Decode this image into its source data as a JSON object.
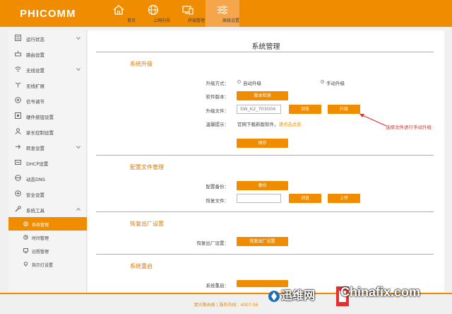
{
  "brand": "PHICOMM",
  "nav": [
    {
      "label": "首页",
      "icon": "home-icon"
    },
    {
      "label": "上网向导",
      "icon": "globe-icon"
    },
    {
      "label": "终端管理",
      "icon": "devices-icon"
    },
    {
      "label": "高级设置",
      "icon": "sliders-icon",
      "active": true
    }
  ],
  "sidebar": {
    "items": [
      {
        "label": "运行状态",
        "icon": "status-icon",
        "expandable": true
      },
      {
        "label": "路由设置",
        "icon": "router-icon"
      },
      {
        "label": "无线设置",
        "icon": "wifi-icon",
        "expandable": true
      },
      {
        "label": "无线扩展",
        "icon": "wireless-extend-icon"
      },
      {
        "label": "信号调节",
        "icon": "signal-icon"
      },
      {
        "label": "硬件按钮设置",
        "icon": "hardware-button-icon"
      },
      {
        "label": "家长控制设置",
        "icon": "parent-control-icon"
      },
      {
        "label": "转发设置",
        "icon": "forward-icon",
        "expandable": true
      },
      {
        "label": "DHCP设置",
        "icon": "dhcp-icon"
      },
      {
        "label": "动态DNS",
        "icon": "ddns-icon"
      },
      {
        "label": "安全设置",
        "icon": "security-icon"
      },
      {
        "label": "系统工具",
        "icon": "wrench-icon",
        "expandable": true,
        "expanded": true
      }
    ],
    "subitems": [
      {
        "label": "系统管理",
        "icon": "system-manage-icon",
        "active": true
      },
      {
        "label": "时间管理",
        "icon": "clock-icon"
      },
      {
        "label": "远程管理",
        "icon": "remote-icon"
      },
      {
        "label": "指示灯设置",
        "icon": "indicator-light-icon"
      }
    ]
  },
  "main": {
    "title": "系统管理",
    "upgrade": {
      "title": "系统升级",
      "mode_label": "升级方式：",
      "auto": "自动升级",
      "manual": "手动升级",
      "selected": "manual",
      "version_label": "软件版本：",
      "check_btn": "版本检测",
      "file_label": "升级文件：",
      "file_value": "SW_K2_703004",
      "browse_btn": "浏览",
      "upgrade_btn": "升级",
      "tip_label": "温馨提示：",
      "tip_text": "官网下载新版软件，",
      "tip_link": "请点击此处",
      "save_btn": "保存"
    },
    "config": {
      "title": "配置文件管理",
      "backup_label": "配置备份：",
      "backup_btn": "备份",
      "restore_label": "恢复文件：",
      "browse_btn": "浏览",
      "upload_btn": "上传"
    },
    "factory": {
      "title": "恢复出厂设置",
      "label": "恢复出厂设置：",
      "btn": "恢复出厂设置"
    },
    "reboot": {
      "title": "系统重启",
      "label": "系统重启："
    }
  },
  "annotation": "选择文件进行手动升级",
  "footer": "斐讯路由器 | 服务热线：4007-56",
  "watermark": {
    "cn": "迅维网",
    "en": "Chinafix.com"
  },
  "colors": {
    "accent": "#f08c00",
    "annotation": "#e53030"
  }
}
